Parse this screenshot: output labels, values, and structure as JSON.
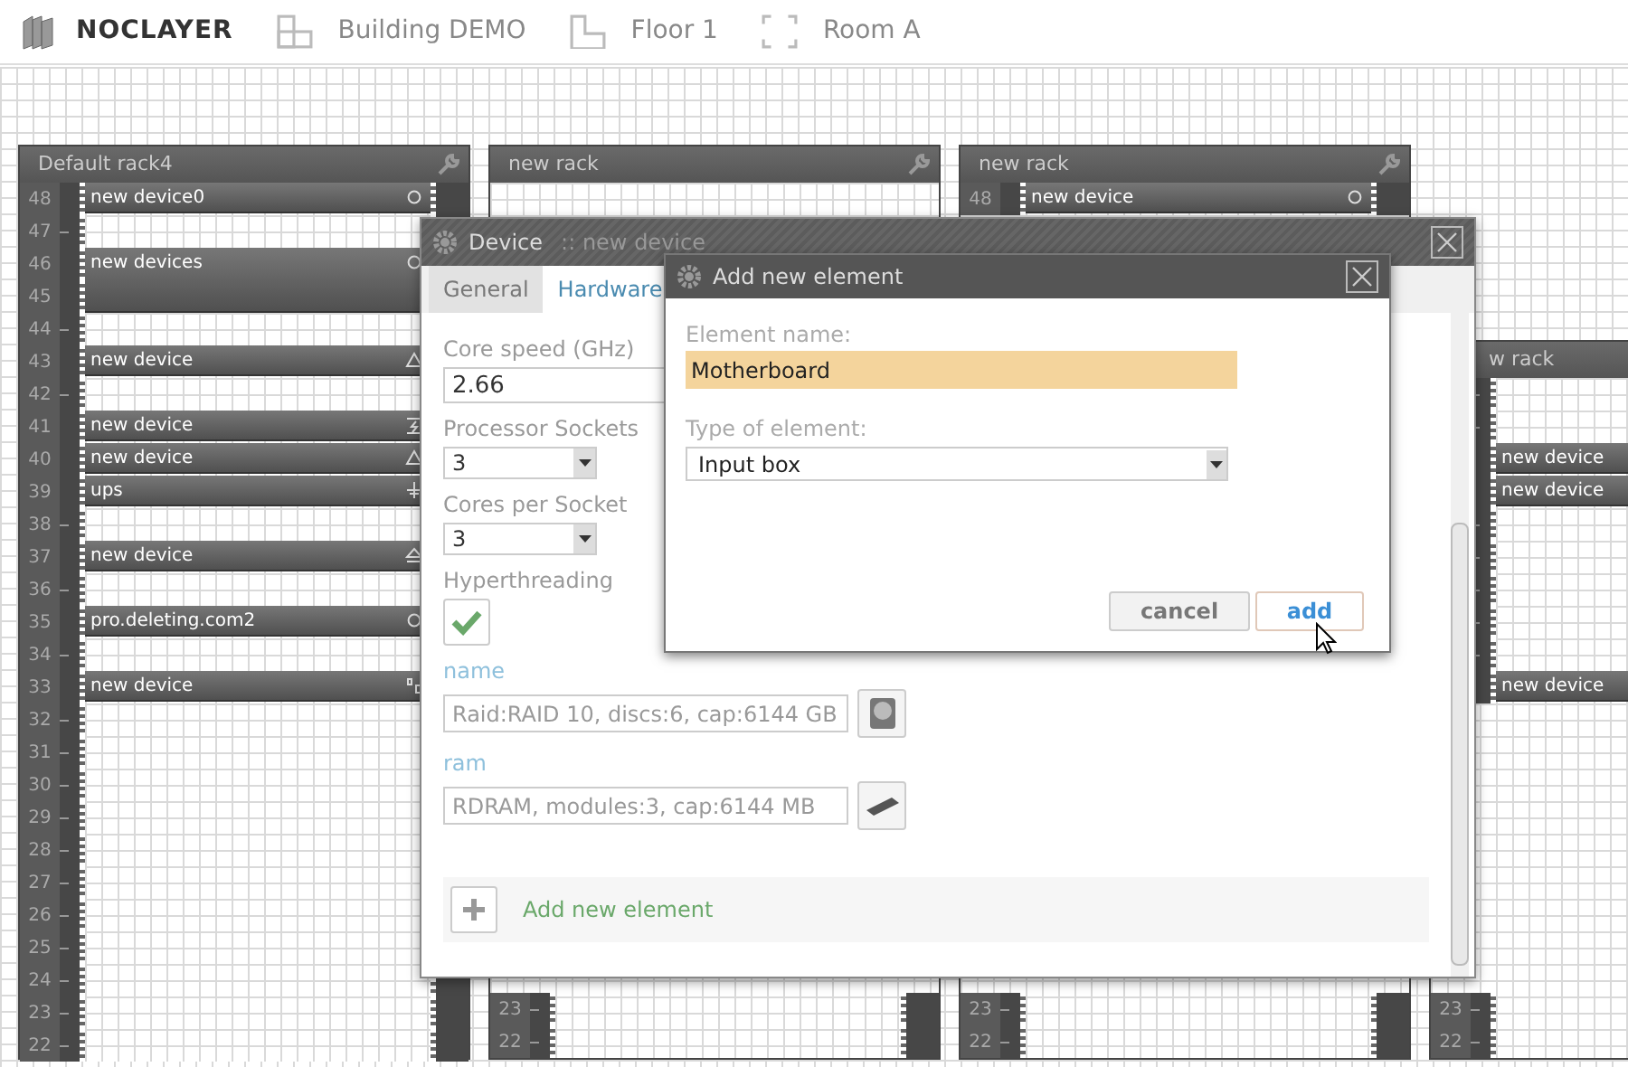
{
  "header": {
    "logo": "NOCLAYER",
    "breadcrumbs": [
      {
        "label": "Building DEMO",
        "kind": "building"
      },
      {
        "label": "Floor 1",
        "kind": "floor"
      },
      {
        "label": "Room A",
        "kind": "room"
      }
    ]
  },
  "racks": [
    {
      "title": "Default rack4",
      "top_rows": [
        {
          "kind": "device",
          "number": "48",
          "device": {
            "name": "new device0",
            "kind": "circle"
          }
        },
        {
          "kind": "empty",
          "number": "47"
        },
        {
          "kind": "device",
          "number": "46",
          "device": {
            "name": "new devices",
            "kind": "circle"
          }
        },
        {
          "kind": "covered",
          "number": "45"
        },
        {
          "kind": "empty",
          "number": "44"
        },
        {
          "kind": "device",
          "number": "43",
          "device": {
            "name": "new device",
            "kind": "triangle"
          }
        },
        {
          "kind": "empty",
          "number": "42"
        },
        {
          "kind": "device",
          "number": "41",
          "device": {
            "name": "new device",
            "kind": "bolt"
          }
        },
        {
          "kind": "device",
          "number": "40",
          "device": {
            "name": "new device",
            "kind": "triangle"
          }
        },
        {
          "kind": "device",
          "number": "39",
          "device": {
            "name": "ups",
            "kind": "ground"
          }
        },
        {
          "kind": "empty",
          "number": "38"
        },
        {
          "kind": "device",
          "number": "37",
          "device": {
            "name": "new device",
            "kind": "eject"
          }
        },
        {
          "kind": "empty",
          "number": "36"
        },
        {
          "kind": "device",
          "number": "35",
          "device": {
            "name": "pro.deleting.com2",
            "kind": "circle"
          }
        },
        {
          "kind": "empty",
          "number": "34"
        },
        {
          "kind": "device",
          "number": "33",
          "device": {
            "name": "new device",
            "kind": "nodes"
          }
        },
        {
          "kind": "empty",
          "number": "32"
        },
        {
          "kind": "empty",
          "number": "31"
        },
        {
          "kind": "empty",
          "number": "30"
        },
        {
          "kind": "empty",
          "number": "29"
        },
        {
          "kind": "empty",
          "number": "28"
        },
        {
          "kind": "empty",
          "number": "27"
        },
        {
          "kind": "empty",
          "number": "26"
        },
        {
          "kind": "empty",
          "number": "25"
        },
        {
          "kind": "empty",
          "number": "24"
        },
        {
          "kind": "empty",
          "number": "23"
        },
        {
          "kind": "empty",
          "number": "22"
        }
      ]
    },
    {
      "title": "new rack",
      "bottom_rows": [
        {
          "kind": "empty",
          "number": "23"
        },
        {
          "kind": "empty",
          "number": "22"
        }
      ]
    },
    {
      "title": "new rack",
      "top_rows": [
        {
          "kind": "device",
          "number": "48",
          "device": {
            "name": "new device",
            "kind": "circle"
          }
        }
      ],
      "bottom_rows": [
        {
          "kind": "empty",
          "number": "23"
        },
        {
          "kind": "empty",
          "number": "22"
        }
      ]
    },
    {
      "title": "w rack",
      "top_rows": [
        {
          "kind": "empty"
        },
        {
          "kind": "empty"
        },
        {
          "kind": "device",
          "device": {
            "name": "new device"
          }
        },
        {
          "kind": "device",
          "device": {
            "name": "new device"
          }
        },
        {
          "kind": "empty"
        },
        {
          "kind": "empty"
        },
        {
          "kind": "empty"
        },
        {
          "kind": "empty"
        },
        {
          "kind": "empty"
        },
        {
          "kind": "device",
          "device": {
            "name": "new device"
          }
        }
      ],
      "bottom_rows": [
        {
          "kind": "empty",
          "number": "23"
        },
        {
          "kind": "empty",
          "number": "22"
        }
      ]
    }
  ],
  "device_dialog": {
    "title": "Device",
    "subtitle": ":: new device",
    "tabs": [
      {
        "label": "General",
        "selected": false
      },
      {
        "label": "Hardware",
        "selected": true
      }
    ],
    "fields": [
      {
        "kind": "text",
        "label": "Core speed (GHz)",
        "value": "2.66"
      },
      {
        "kind": "select",
        "label": "Processor Sockets",
        "value": "3"
      },
      {
        "kind": "select",
        "label": "Cores per Socket",
        "value": "3"
      },
      {
        "kind": "checkbox",
        "label": "Hyperthreading",
        "checked": true
      },
      {
        "kind": "disk",
        "label": "name",
        "placeholder": "Raid:RAID 10, discs:6, cap:6144 GB"
      },
      {
        "kind": "memory",
        "label": "ram",
        "placeholder": "RDRAM, modules:3, cap:6144 MB"
      }
    ],
    "add_element": {
      "label": "Add new element"
    }
  },
  "add_element_dialog": {
    "title": "Add new element",
    "name_label": "Element name:",
    "name_value": "Motherboard",
    "type_label": "Type of element:",
    "type_value": "Input box",
    "buttons": [
      {
        "label": "cancel",
        "kind": "secondary"
      },
      {
        "label": "add",
        "kind": "primary"
      }
    ]
  }
}
